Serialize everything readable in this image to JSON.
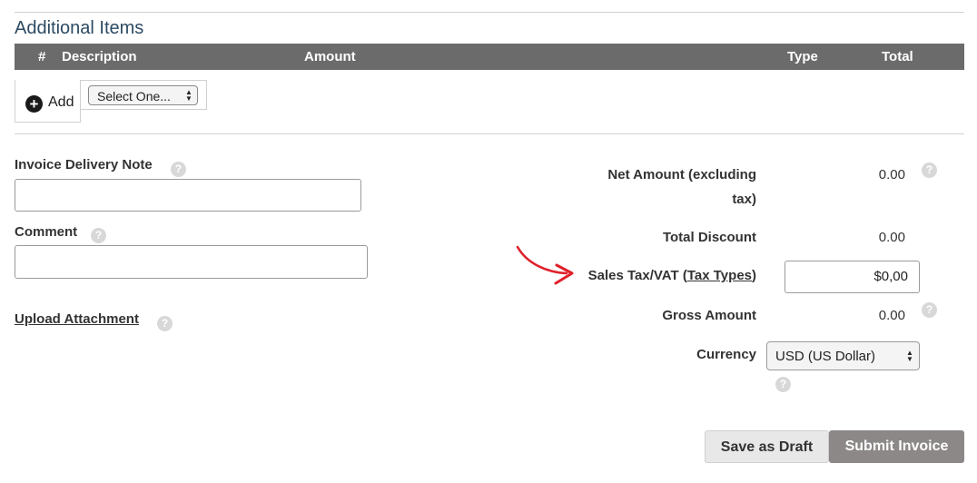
{
  "additional_items": {
    "title": "Additional Items",
    "columns": [
      "#",
      "Description",
      "Amount",
      "Type",
      "Total"
    ],
    "add_label": "Add",
    "type_select_value": "Select One..."
  },
  "left_form": {
    "delivery_note_label": "Invoice Delivery Note",
    "delivery_note_value": "",
    "comment_label": "Comment",
    "comment_value": "",
    "upload_label": "Upload Attachment"
  },
  "summary": {
    "net_amount_label_line1": "Net Amount (excluding",
    "net_amount_label_line2": "tax)",
    "net_amount_value": "0.00",
    "total_discount_label": "Total Discount",
    "total_discount_value": "0.00",
    "sales_tax_label": "Sales Tax/VAT",
    "tax_types_link": "Tax Types",
    "sales_tax_value": "$0,00",
    "gross_amount_label": "Gross Amount",
    "gross_amount_value": "0.00",
    "currency_label": "Currency",
    "currency_value": "USD (US Dollar)"
  },
  "actions": {
    "save_draft_label": "Save as Draft",
    "submit_label": "Submit Invoice"
  },
  "colors": {
    "header_bg": "#6b6b6b",
    "annotation_arrow": "#e0202a",
    "submit_bg": "#8c8888"
  }
}
